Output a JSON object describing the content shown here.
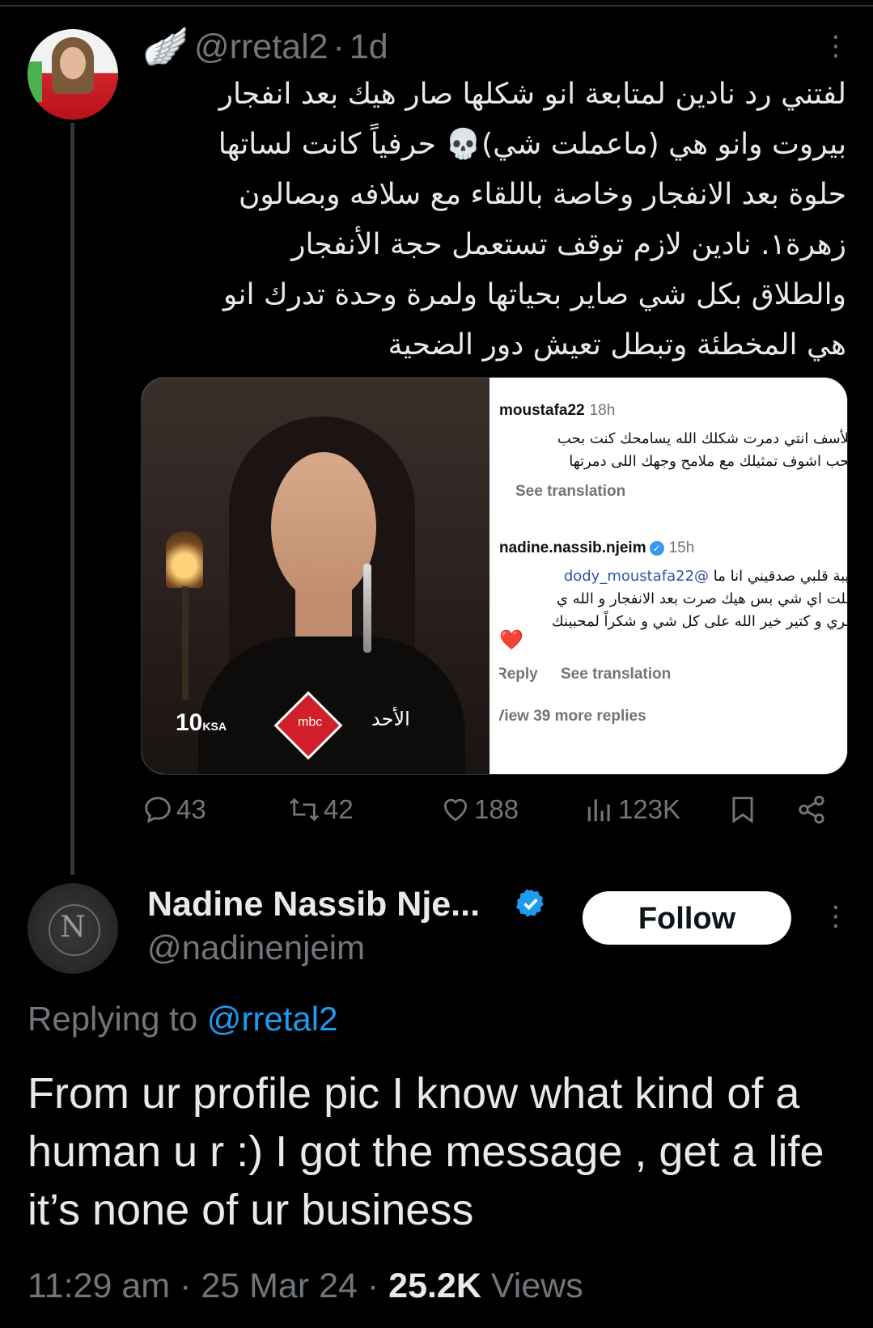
{
  "parent_tweet": {
    "handle": "@rretal2",
    "time": "1d",
    "text_lines": [
      "لفتني رد نادين لمتابعة انو شكلها صار هيك بعد انفجار",
      "بيروت وانو هي (ماعملت شي)💀 حرفياً كانت لساتها",
      "حلوة بعد الانفجار وخاصة باللقاء مع سلافه وبصالون",
      "زهرة١. نادين لازم توقف تستعمل حجة الأنفجار",
      "والطلاق بكل شي صاير بحياتها ولمرة وحدة تدرك انو",
      "هي المخطئة وتبطل تعيش دور الضحية"
    ],
    "media": {
      "photo": {
        "channel": "10",
        "channel_sub": "KSA",
        "logo": "mbc",
        "day": "الأحد"
      },
      "screenshot": {
        "comment1_user": "moustafa22",
        "comment1_time": "18h",
        "comment1_lines": [
          "للأسف انتي دمرت شكلك الله يسامحك كنت بحب",
          "يحب اشوف تمثيلك مع ملامح وجهك اللى دمرتها"
        ],
        "see_translation": "See translation",
        "comment2_user": "nadine.nassib.njeim",
        "comment2_time": "15h",
        "comment2_mention": "@dody_moustafa22",
        "comment2_first": "بيبة قلبي صدقيني انا ما",
        "comment2_lines": [
          "ملت اي شي بس هيك صرت بعد الانفجار و الله ي",
          "مري و كتير خير الله على كل شي و شكراً لمحبينك"
        ],
        "reply": "Reply",
        "view_more": "View 39 more replies"
      }
    },
    "actions": {
      "replies": "43",
      "reposts": "42",
      "likes": "188",
      "views": "123K"
    }
  },
  "reply_tweet": {
    "name": "Nadine Nassib Nje...",
    "handle": "@nadinenjeim",
    "follow_label": "Follow",
    "replying_prefix": "Replying to",
    "replying_to": "@rretal2",
    "text": "From ur profile pic I know what kind of a human u r :) I got the message , get a life it’s none of ur business",
    "time": "11:29 am",
    "date": "25 Mar 24",
    "views_count": "25.2K",
    "views_label": "Views"
  },
  "colors": {
    "background": "#000000",
    "text": "#e7e9ea",
    "secondary": "#71767b",
    "link": "#1d9bf0",
    "verified": "#1d9bf0"
  }
}
